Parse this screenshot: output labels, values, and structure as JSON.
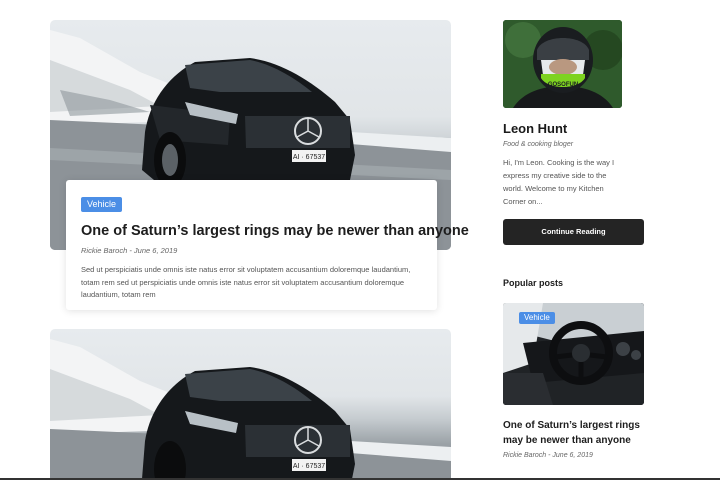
{
  "featured_post": {
    "category": "Vehicle",
    "title": "One of Saturn’s largest rings may be newer than anyone",
    "author": "Rickie Baroch",
    "date": "June 6, 2019",
    "meta": "Rickie Baroch - June 6, 2019",
    "excerpt": "Sed ut perspiciatis unde omnis iste natus error sit voluptatem accusantium doloremque laudantium, totam rem sed ut perspiciatis unde omnis iste natus error sit voluptatem accusantium doloremque laudantium, totam rem",
    "image_alt": "Black car on a snowy mountain road",
    "license_plate": "AI · 67537"
  },
  "second_post": {
    "image_alt": "Black car on a snowy mountain road",
    "license_plate": "AI · 67537"
  },
  "author": {
    "name": "Leon Hunt",
    "role": "Food & cooking bloger",
    "bio": "Hi, I'm Leon. Cooking is the way I express my creative side to the world. Welcome to my Kitchen Corner on...",
    "continue_label": "Continue Reading",
    "photo_alt": "Rider in a helmet",
    "helmet_text": "GOSOFUN"
  },
  "popular": {
    "heading": "Popular posts",
    "post": {
      "category": "Vehicle",
      "title": "One of Saturn’s largest rings may be newer than anyone",
      "meta": "Rickie Baroch - June 6, 2019",
      "image_alt": "Car interior with steering wheel"
    }
  },
  "colors": {
    "accent": "#4b8ee6",
    "button_bg": "#242424",
    "text_dark": "#1d1d1d",
    "text_muted": "#666666"
  }
}
